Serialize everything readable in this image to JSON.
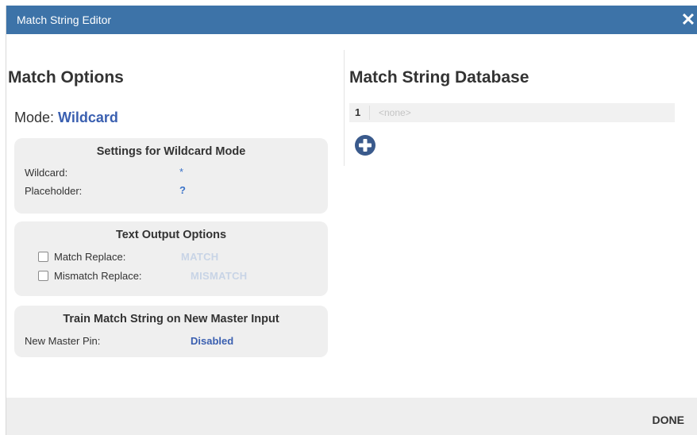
{
  "window": {
    "title": "Match String Editor",
    "close_glyph": "✕"
  },
  "left": {
    "heading": "Match Options",
    "mode_label": "Mode:",
    "mode_value": "Wildcard",
    "wildcard_panel": {
      "title": "Settings for Wildcard Mode",
      "rows": [
        {
          "label": "Wildcard:",
          "value": "*"
        },
        {
          "label": "Placeholder:",
          "value": "?"
        }
      ]
    },
    "text_output_panel": {
      "title": "Text Output Options",
      "rows": [
        {
          "label": "Match Replace:",
          "value": "MATCH",
          "checked": false
        },
        {
          "label": "Mismatch Replace:",
          "value": "MISMATCH",
          "checked": false
        }
      ]
    },
    "train_panel": {
      "title": "Train Match String on New Master Input",
      "rows": [
        {
          "label": "New Master Pin:",
          "value": "Disabled"
        }
      ]
    }
  },
  "right": {
    "heading": "Match String Database",
    "rows": [
      {
        "index": "1",
        "value": "<none>"
      }
    ],
    "add_icon": "plus-circle-icon"
  },
  "footer": {
    "done_label": "DONE"
  },
  "colors": {
    "titlebar": "#3d73a8",
    "accent_blue": "#3a5fb0",
    "panel_bg": "#efefef",
    "footer_bg": "#eeeeee"
  }
}
